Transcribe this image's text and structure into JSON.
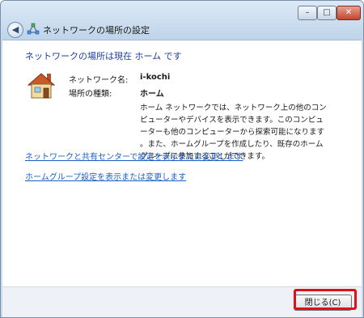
{
  "window": {
    "title": "ネットワークの場所の設定",
    "controls": {
      "minimize": "–",
      "maximize": "□",
      "close": "✕"
    },
    "back_glyph": "◀"
  },
  "main": {
    "heading": "ネットワークの場所は現在 ホーム です",
    "network_name_label": "ネットワーク名:",
    "network_name_value": "i-kochi",
    "location_type_label": "場所の種類:",
    "location_type_value": "ホーム",
    "description_lines": [
      "ホーム ネットワークでは、ネットワーク上の他のコン",
      "ピューターやデバイスを表示できます。このコンピュ",
      "ーターも他のコンピューターから探索可能になります",
      "。また、ホームグループを作成したり、既存のホーム",
      "グループに参加することができます。"
    ],
    "links": {
      "network_center": "ネットワークと共有センターで設定を表示または変更します",
      "homegroup": "ホームグループ設定を表示または変更します"
    }
  },
  "footer": {
    "close_button": "閉じる(C)"
  },
  "icons": {
    "network": "network-icon",
    "house": "house-icon"
  },
  "colors": {
    "link": "#1f5fc4",
    "heading": "#1e3f9c",
    "highlight": "#e0101a"
  }
}
